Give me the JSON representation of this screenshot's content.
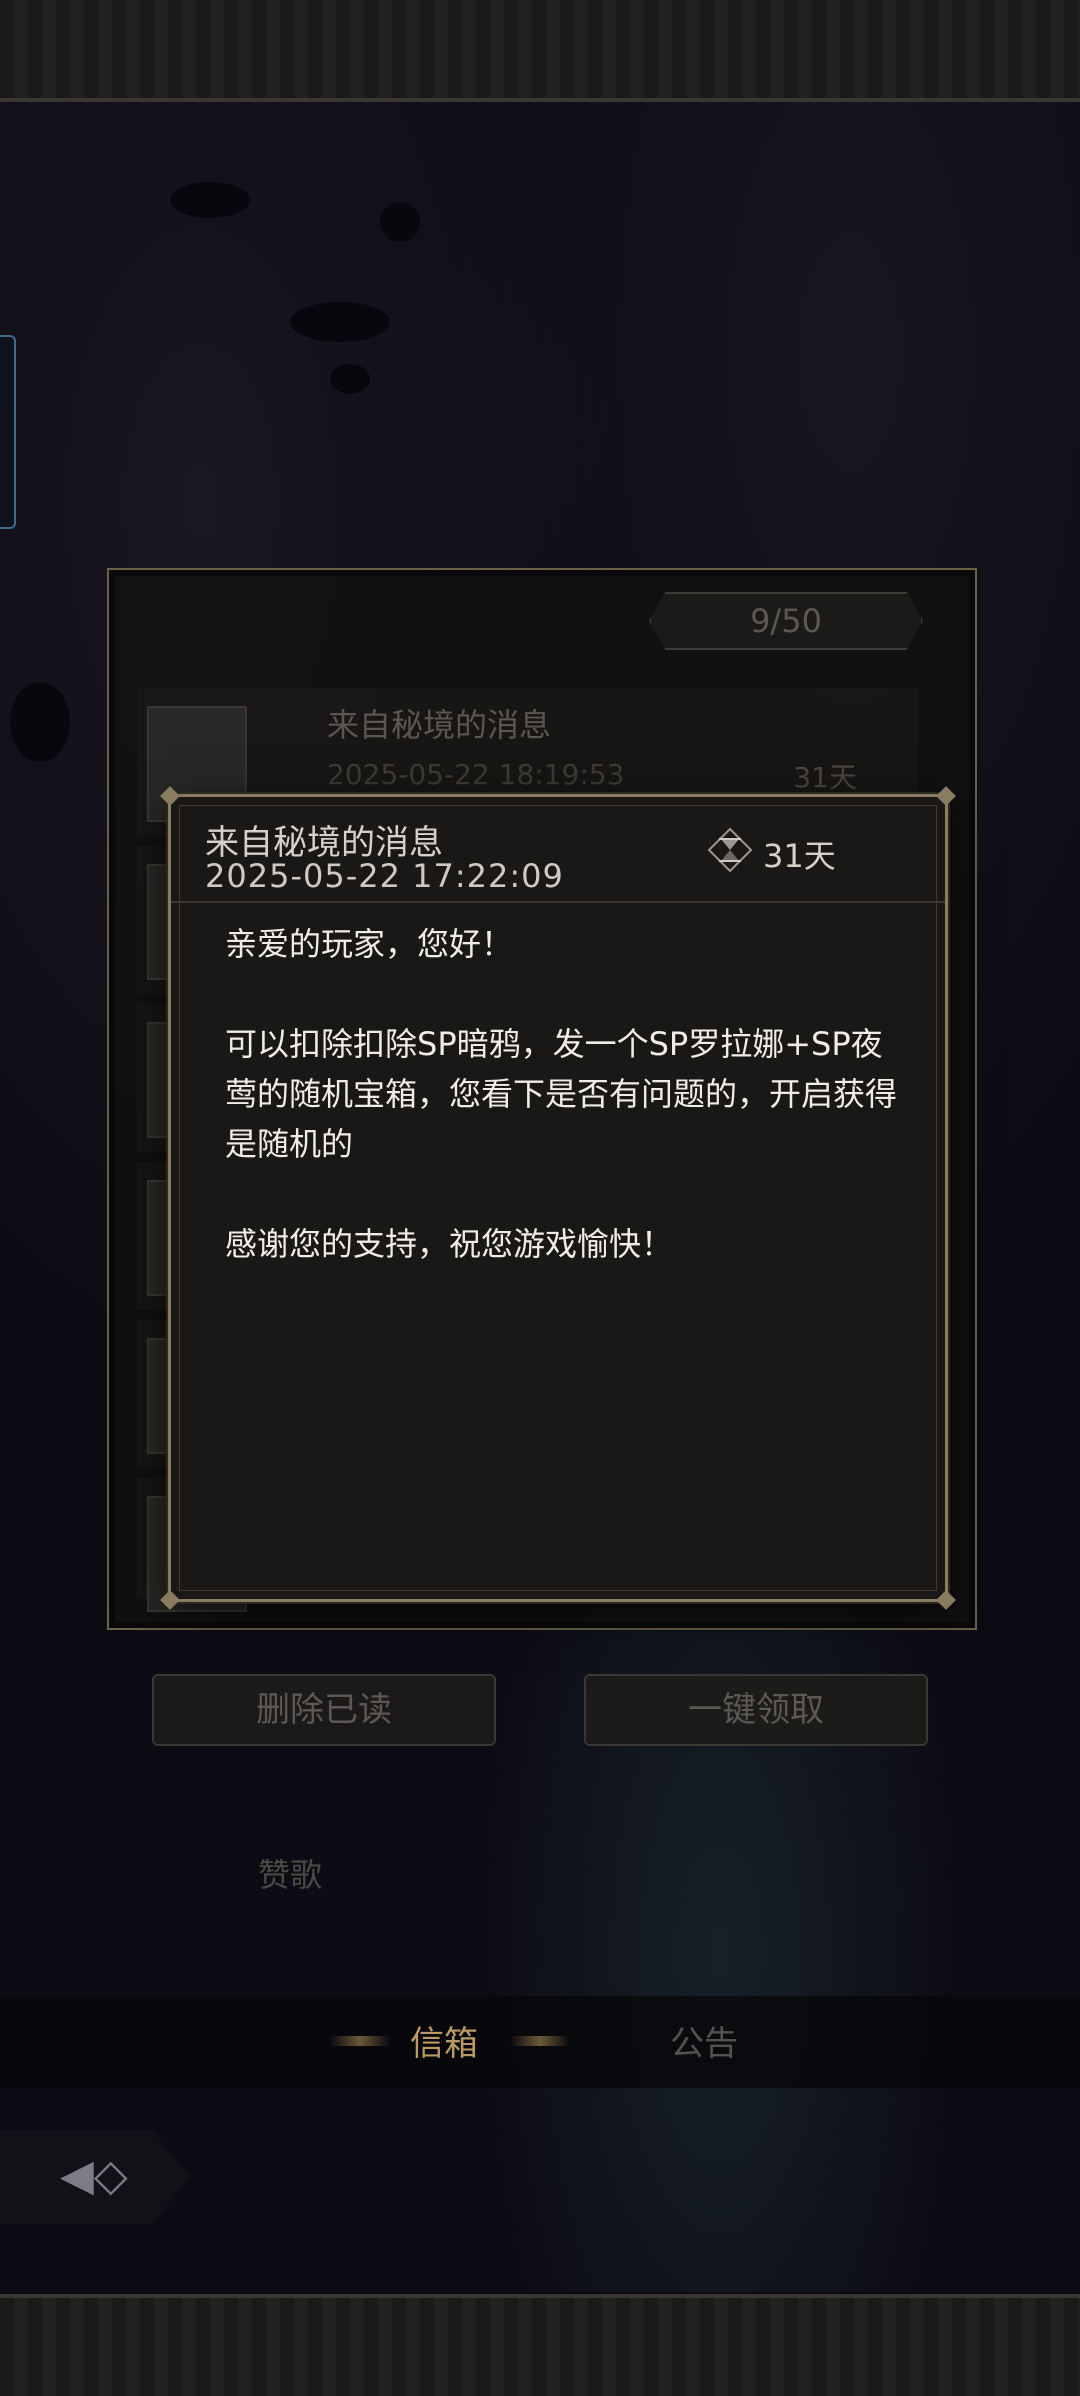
{
  "list": {
    "count": "9/50",
    "rows": [
      {
        "title": "来自秘境的消息",
        "date": "2025-05-22 18:19:53",
        "days": "31天"
      }
    ]
  },
  "actions": {
    "delete_read": "删除已读",
    "claim_all": "一键领取"
  },
  "background_label": "赞歌",
  "tabs": [
    {
      "label": "信箱",
      "active": true
    },
    {
      "label": "公告",
      "active": false
    }
  ],
  "detail": {
    "title": "来自秘境的消息",
    "datetime": "2025-05-22  17:22:09",
    "days": "31天",
    "body": "亲爱的玩家，您好！\n\n可以扣除扣除SP暗鸦，发一个SP罗拉娜+SP夜莺的随机宝箱，您看下是否有问题的，开启获得是随机的\n\n感谢您的支持，祝您游戏愉快！"
  },
  "colors": {
    "frame_gold": "#8a7c5e",
    "panel_bg": "#1a1817",
    "tab_active": "#b99a66"
  }
}
